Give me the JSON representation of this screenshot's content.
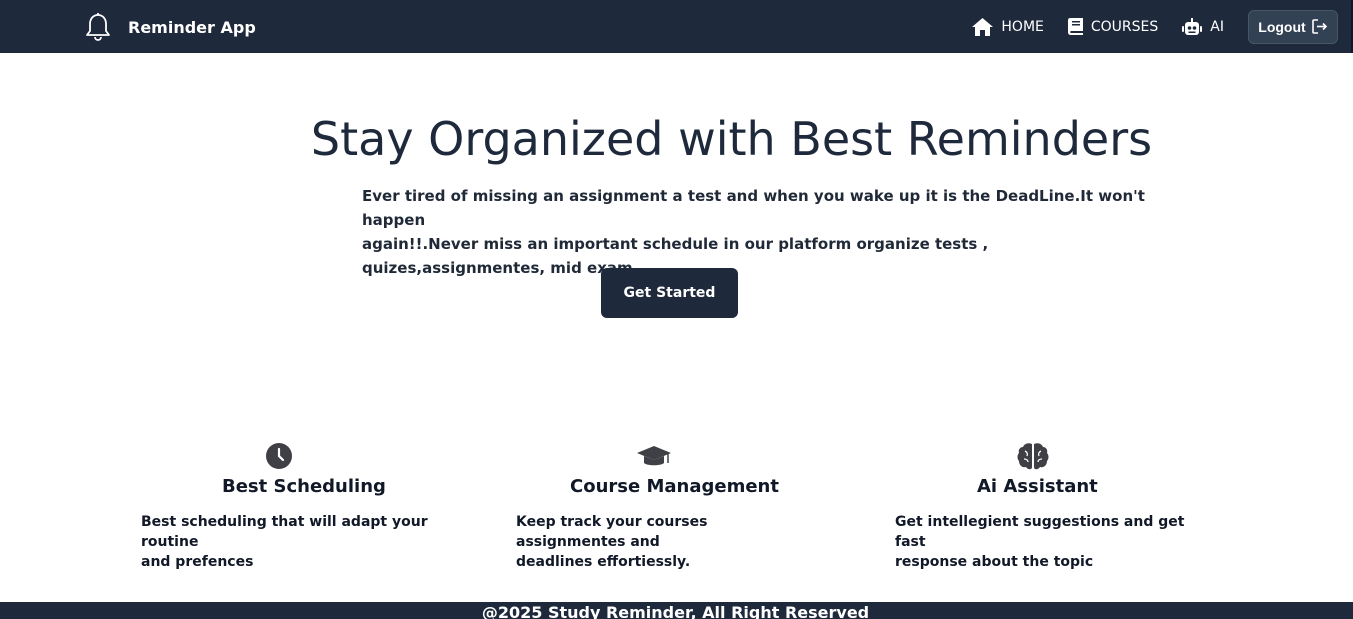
{
  "brand": {
    "title": "Reminder App",
    "icon": "bell-icon"
  },
  "nav": {
    "home": "HOME",
    "courses": "COURSES",
    "ai": "AI",
    "logout": "Logout"
  },
  "hero": {
    "title": "Stay Organized with Best Reminders",
    "line1": "Ever tired of missing an assignment a test and when you wake up it is the DeadLine.It won't happen",
    "line2": "again!!.Never miss an important schedule in our platform organize tests , quizes,assignmentes, mid exam....",
    "cta": "Get Started"
  },
  "features": [
    {
      "icon": "clock-icon",
      "title": "Best Scheduling",
      "line1": "Best scheduling that will adapt your routine",
      "line2": "and prefences"
    },
    {
      "icon": "graduation-cap-icon",
      "title": "Course Management",
      "line1": "Keep track your courses assignmentes and",
      "line2": "deadlines effortiessly."
    },
    {
      "icon": "brain-icon",
      "title": "Ai Assistant",
      "line1": "Get intellegient suggestions and get fast",
      "line2": "response about the topic"
    }
  ],
  "footer": {
    "text": "@2025 Study Reminder, All Right Reserved"
  },
  "colors": {
    "navbar": "#1e293b",
    "accent": "#1e293b",
    "text": "#1f2937"
  }
}
